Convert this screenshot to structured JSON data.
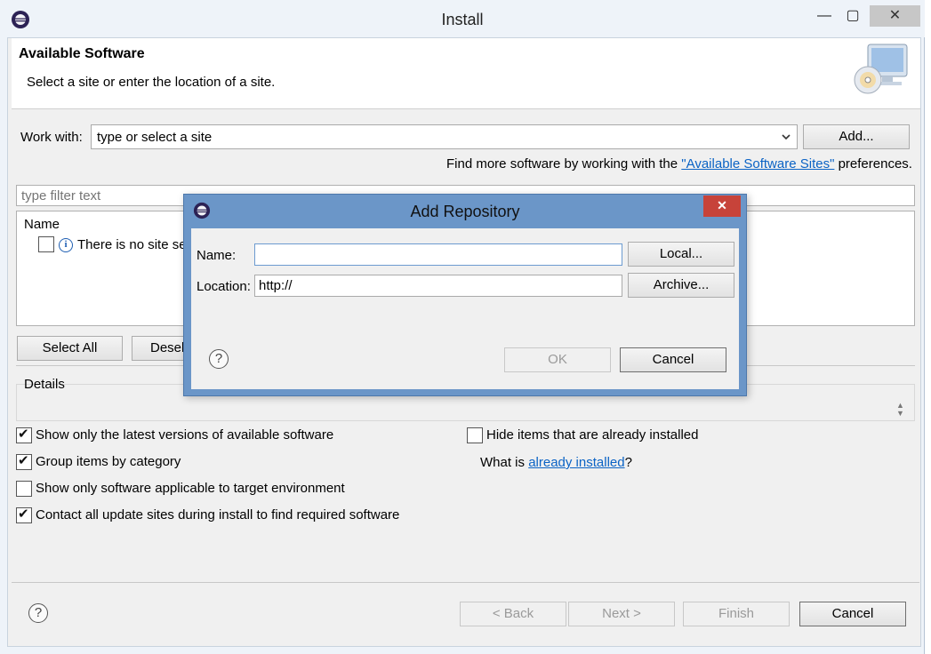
{
  "window": {
    "title": "Install",
    "min_glyph": "—",
    "max_glyph": "▢",
    "close_glyph": "✕"
  },
  "header": {
    "title": "Available Software",
    "subtitle": "Select a site or enter the location of a site."
  },
  "work_with": {
    "label": "Work with:",
    "value": "type or select a site",
    "add_label": "Add...",
    "find_more_prefix": "Find more software by working with the ",
    "find_more_link": "\"Available Software Sites\"",
    "find_more_suffix": " preferences."
  },
  "filter": {
    "placeholder": "type filter text"
  },
  "tree": {
    "column_name": "Name",
    "message": "There is no site sel"
  },
  "buttons": {
    "select_all": "Select All",
    "deselect_all": "Desel"
  },
  "details": {
    "label": "Details"
  },
  "options": {
    "latest_versions": {
      "label": "Show only the latest versions of available software",
      "checked": true
    },
    "group_by_category": {
      "label": "Group items by category",
      "checked": true
    },
    "target_env": {
      "label": "Show only software applicable to target environment",
      "checked": false
    },
    "contact_sites": {
      "label": "Contact all update sites during install to find required software",
      "checked": true
    },
    "hide_installed": {
      "label": "Hide items that are already installed",
      "checked": false
    },
    "what_is_prefix": "What is ",
    "what_is_link": "already installed",
    "what_is_suffix": "?"
  },
  "footer": {
    "help_glyph": "?",
    "back": "< Back",
    "next": "Next >",
    "finish": "Finish",
    "cancel": "Cancel"
  },
  "dialog": {
    "title": "Add Repository",
    "close_glyph": "✕",
    "name_label": "Name:",
    "name_value": "",
    "local_label": "Local...",
    "location_label": "Location:",
    "location_value": "http://",
    "archive_label": "Archive...",
    "help_glyph": "?",
    "ok_label": "OK",
    "cancel_label": "Cancel"
  },
  "colors": {
    "dialog_frame": "#6b96c8",
    "close_red": "#c7433a",
    "link": "#0b63c5"
  }
}
